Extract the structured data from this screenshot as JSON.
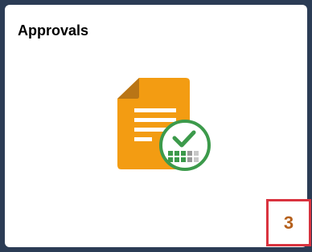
{
  "tile": {
    "title": "Approvals",
    "badge_count": "3",
    "icon": "document-approved-icon"
  },
  "colors": {
    "page_background": "#2b3c55",
    "tile_background": "#ffffff",
    "document_orange": "#f39c12",
    "document_fold": "#b97516",
    "check_green": "#3c9a4b",
    "badge_text": "#b5601c",
    "highlight_border": "#d9333f"
  }
}
